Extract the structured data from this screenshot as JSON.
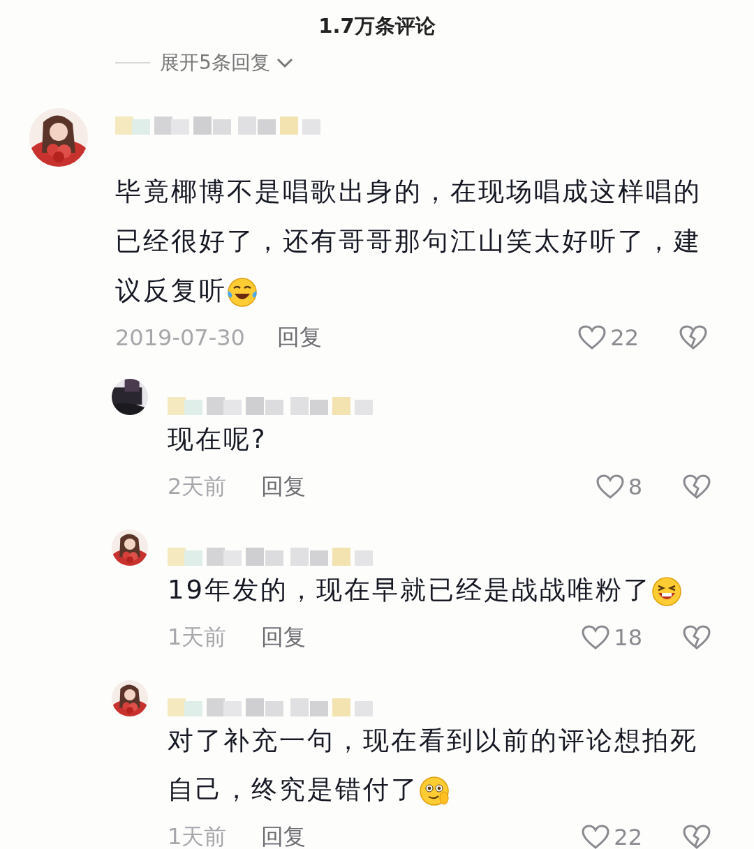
{
  "header": {
    "title": "1.7万条评论"
  },
  "expand_replies": {
    "label": "展开5条回复"
  },
  "comments": [
    {
      "kind": "top",
      "text": "毕竟椰博不是唱歌出身的，在现场唱成这样唱的已经很好了，还有哥哥那句江山笑太好听了，建议反复听",
      "emoji": {
        "kind": "laugh_cry"
      },
      "date": "2019-07-30",
      "reply_label": "回复",
      "likes": "22"
    },
    {
      "kind": "reply",
      "text": "现在呢?",
      "date": "2天前",
      "reply_label": "回复",
      "likes": "8"
    },
    {
      "kind": "reply",
      "text": "19年发的，现在早就已经是战战唯粉了",
      "emoji": {
        "kind": "grin"
      },
      "date": "1天前",
      "reply_label": "回复",
      "likes": "18"
    },
    {
      "kind": "reply",
      "text": "对了补充一句，现在看到以前的评论想拍死自己，终究是错付了",
      "emoji": {
        "kind": "smile_hand"
      },
      "date": "1天前",
      "reply_label": "回复",
      "likes": "22"
    }
  ]
}
